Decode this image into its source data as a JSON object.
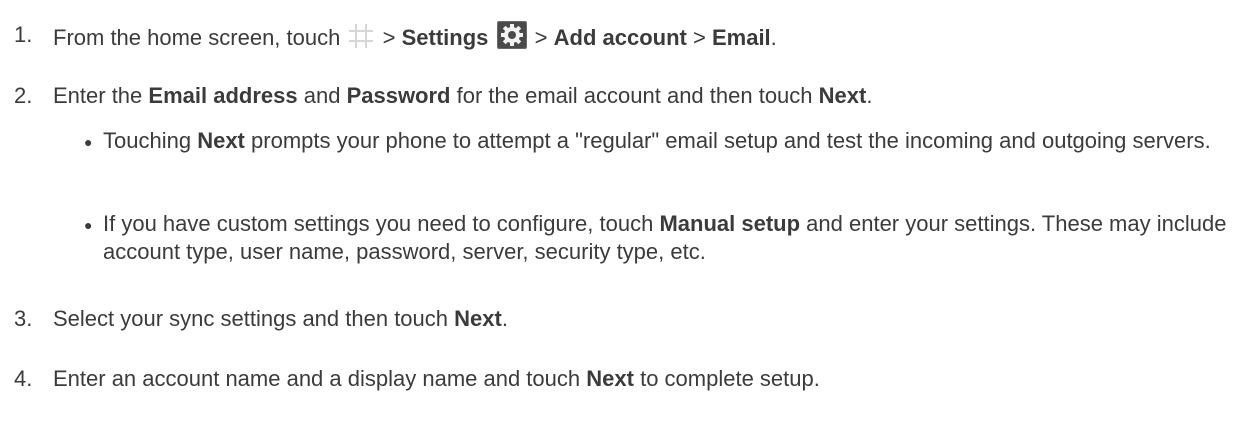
{
  "steps": [
    {
      "num": "1.",
      "prefix": "From the home screen, touch",
      "sep1": ">",
      "settings": "Settings",
      "sep2": ">",
      "add_account": "Add account",
      "sep3": ">",
      "email": "Email",
      "end": "."
    },
    {
      "num": "2.",
      "p1": "Enter the",
      "email_address": "Email address",
      "p2": "and",
      "password": "Password",
      "p3": "for the email account and then touch",
      "next": "Next",
      "end": "."
    },
    {
      "num": "3.",
      "p1": "Select your sync settings and then touch",
      "next": "Next",
      "end": "."
    },
    {
      "num": "4.",
      "p1": "Enter an account name and a display name and touch",
      "next": "Next",
      "p2": "to complete setup."
    }
  ],
  "bullets": [
    {
      "p1": "Touching",
      "next": "Next",
      "p2": "prompts your phone to attempt a \"regular\" email setup and test the incoming and outgoing servers."
    },
    {
      "p1": "If you have custom settings you need to configure, touch",
      "manual_setup": "Manual setup",
      "p2": "and enter your settings. These may include account type, user name, password, server, security type, etc."
    }
  ],
  "bullet_glyph": "●",
  "icons": {
    "apps": "apps-grid-icon",
    "settings": "settings-gear-icon"
  },
  "colors": {
    "text": "#3b3b3b",
    "icon_grid": "#d6d6d6",
    "gear_bg": "#5a5a5a"
  }
}
